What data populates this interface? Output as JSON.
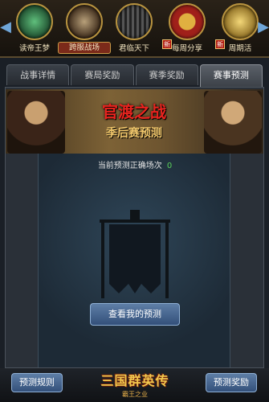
{
  "topbar": {
    "items": [
      {
        "label": "读帝王梦",
        "icon": "jade-dragon-icon",
        "color": "#2a5e3a",
        "new": false
      },
      {
        "label": "跨服战场",
        "icon": "warrior-helmet-icon",
        "color": "#5a3a2a",
        "new": false,
        "active": true
      },
      {
        "label": "君临天下",
        "icon": "army-crowd-icon",
        "color": "#3a3a3a",
        "new": false
      },
      {
        "label": "每周分享",
        "icon": "gift-box-icon",
        "color": "#7a2a1a",
        "new": true
      },
      {
        "label": "周期活",
        "icon": "scroll-icon",
        "color": "#7a6a2a",
        "new": true
      }
    ],
    "new_badge": "新"
  },
  "tabs": [
    {
      "label": "战事详情"
    },
    {
      "label": "赛局奖励"
    },
    {
      "label": "赛季奖励"
    },
    {
      "label": "赛事预测",
      "active": true
    }
  ],
  "banner": {
    "title": "官渡之战",
    "subtitle": "季后赛预测"
  },
  "prediction": {
    "label": "当前预测正确场次",
    "count": "0",
    "button": "查看我的预测"
  },
  "bottom": {
    "rules_button": "预测规则",
    "reward_button": "预测奖励",
    "logo_main": "三国群英传",
    "logo_sub": "霸王之业"
  }
}
